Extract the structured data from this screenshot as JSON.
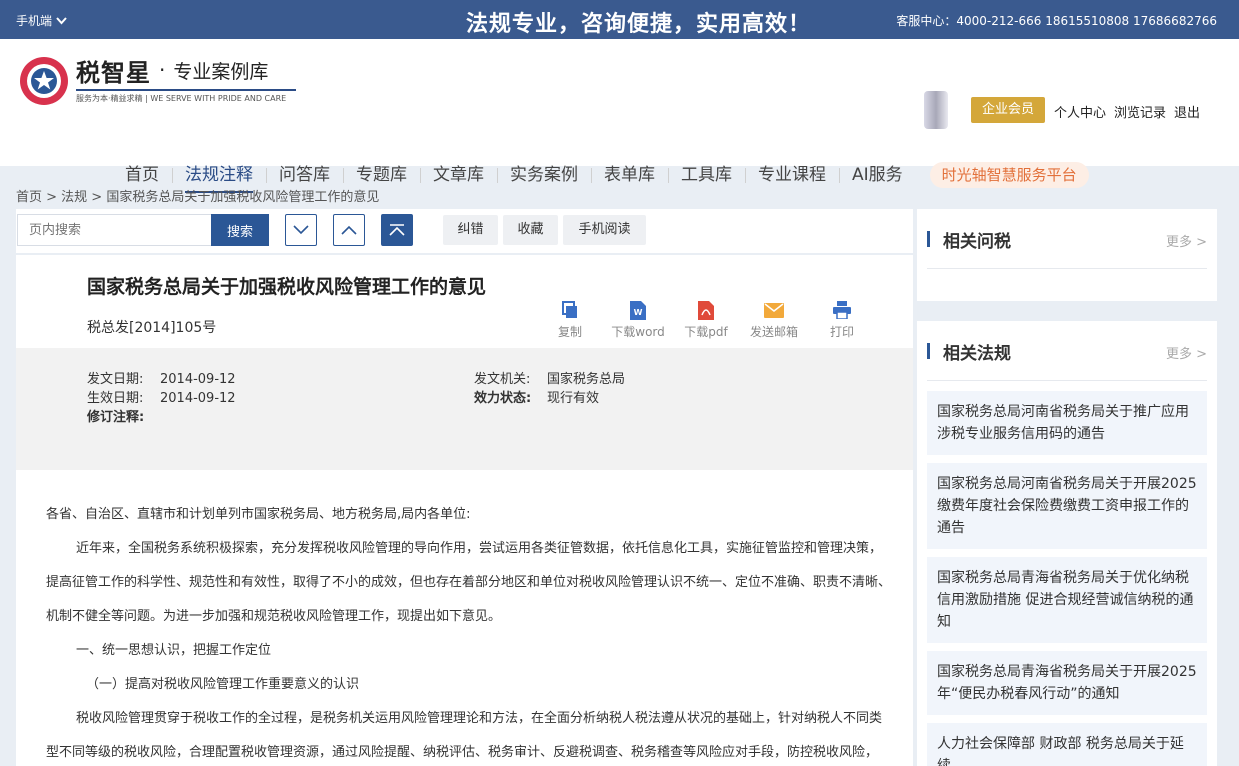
{
  "topbar": {
    "mobile_label": "手机端",
    "slogan": "法规专业，咨询便捷，实用高效！",
    "hotline": "客服中心：4000-212-666 18615510808 17686682766"
  },
  "header": {
    "brand": "税智星",
    "dot": "·",
    "subtitle": "专业案例库",
    "tagline": "服务为本·精益求精 | WE SERVE WITH PRIDE AND CARE",
    "member_button": "企业会员",
    "user_links": [
      "个人中心",
      "浏览记录",
      "退出"
    ]
  },
  "nav": {
    "items": [
      "首页",
      "法规注释",
      "问答库",
      "专题库",
      "文章库",
      "实务案例",
      "表单库",
      "工具库",
      "专业课程",
      "AI服务"
    ],
    "active_index": 1,
    "special": "时光轴智慧服务平台"
  },
  "breadcrumb": "首页 > 法规 > 国家税务总局关于加强税收风险管理工作的意见",
  "toolbar": {
    "search_placeholder": "页内搜索",
    "search_button": "搜索",
    "buttons": [
      "纠错",
      "收藏",
      "手机阅读"
    ]
  },
  "doc": {
    "title": "国家税务总局关于加强税收风险管理工作的意见",
    "number": "税总发[2014]105号",
    "actions": [
      {
        "label": "复制",
        "icon": "copy-icon",
        "color": "#3a6fc4"
      },
      {
        "label": "下载word",
        "icon": "word-icon",
        "color": "#3a6fc4"
      },
      {
        "label": "下载pdf",
        "icon": "pdf-icon",
        "color": "#e04a3a"
      },
      {
        "label": "发送邮箱",
        "icon": "mail-icon",
        "color": "#f2a93b"
      },
      {
        "label": "打印",
        "icon": "print-icon",
        "color": "#3a6fc4"
      }
    ],
    "meta": {
      "issue_date_label": "发文日期:",
      "issue_date": "2014-09-12",
      "effective_date_label": "生效日期:",
      "effective_date": "2014-09-12",
      "revision_label": "修订注释:",
      "issuer_label": "发文机关:",
      "issuer": "国家税务总局",
      "status_label": "效力状态:",
      "status": "现行有效"
    },
    "paragraphs": [
      "各省、自治区、直辖市和计划单列市国家税务局、地方税务局,局内各单位:",
      "近年来，全国税务系统积极探索，充分发挥税收风险管理的导向作用，尝试运用各类征管数据，依托信息化工具，实施征管监控和管理决策，提高征管工作的科学性、规范性和有效性，取得了不小的成效，但也存在着部分地区和单位对税收风险管理认识不统一、定位不准确、职责不清晰、机制不健全等问题。为进一步加强和规范税收风险管理工作，现提出如下意见。",
      "一、统一思想认识，把握工作定位",
      "（一）提高对税收风险管理工作重要意义的认识",
      "税收风险管理贯穿于税收工作的全过程，是税务机关运用风险管理理论和方法，在全面分析纳税人税法遵从状况的基础上，针对纳税人不同类型不同等级的税收风险，合理配置税收管理资源，通过风险提醒、纳税评估、税务审计、反避税调查、税务稽查等风险应对手段，防控税收风险，"
    ]
  },
  "sidebar": {
    "qa": {
      "title": "相关问税",
      "more": "更多 >"
    },
    "laws": {
      "title": "相关法规",
      "more": "更多 >",
      "items": [
        "国家税务总局河南省税务局关于推广应用涉税专业服务信用码的通告",
        "国家税务总局河南省税务局关于开展2025缴费年度社会保险费缴费工资申报工作的通告",
        "国家税务总局青海省税务局关于优化纳税信用激励措施 促进合规经营诚信纳税的通知",
        "国家税务总局青海省税务局关于开展2025年“便民办税春风行动”的通知",
        "人力社会保障部 财政部 税务总局关于延续"
      ]
    }
  }
}
